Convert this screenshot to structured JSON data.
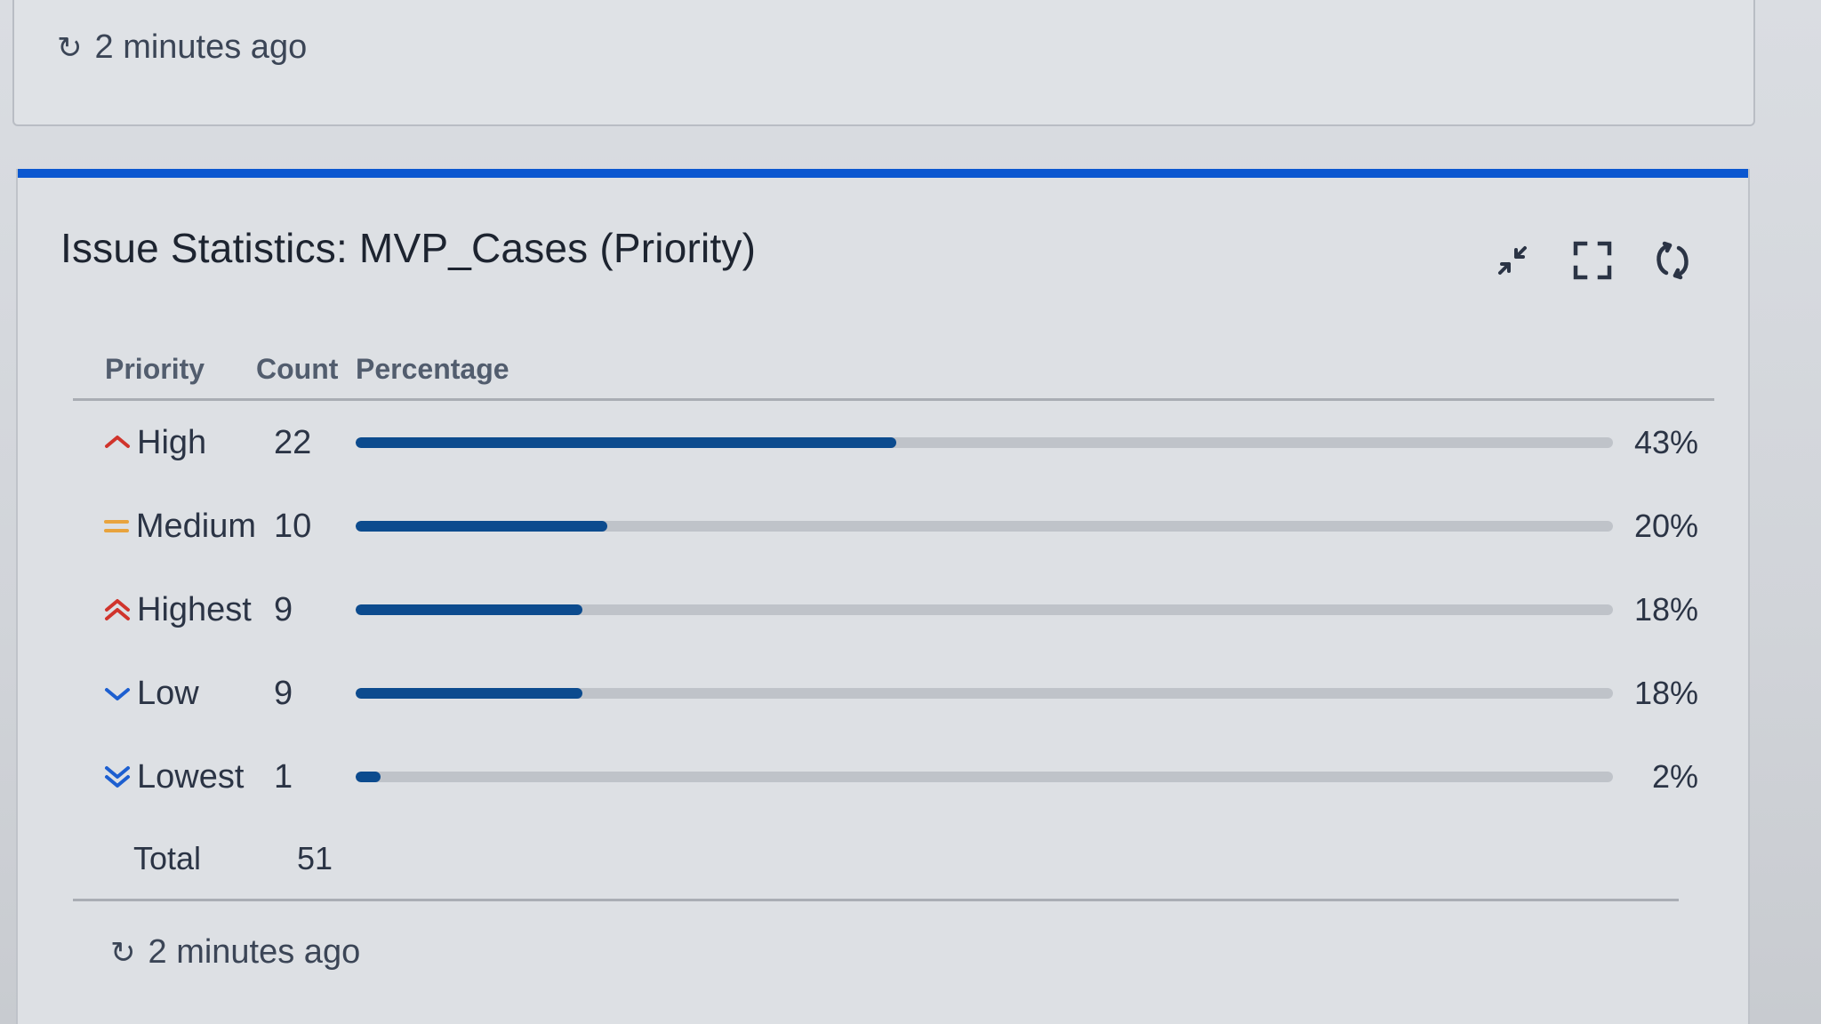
{
  "top_gadget": {
    "refreshed": "2 minutes ago",
    "refresh_icon": "refresh-icon"
  },
  "gadget": {
    "title": "Issue Statistics: MVP_Cases (Priority)",
    "accent_color": "#0b57d0",
    "controls": [
      {
        "name": "minimize",
        "icon": "minimize-icon"
      },
      {
        "name": "maximize",
        "icon": "fullscreen-icon"
      },
      {
        "name": "refresh",
        "icon": "refresh-icon"
      }
    ],
    "columns": {
      "priority": "Priority",
      "count": "Count",
      "percentage": "Percentage"
    },
    "rows": [
      {
        "priority": "High",
        "count": "22",
        "percent": "43%",
        "fraction": 0.43,
        "icon": "priority-high-icon",
        "icon_color": "#d0342c"
      },
      {
        "priority": "Medium",
        "count": "10",
        "percent": "20%",
        "fraction": 0.2,
        "icon": "priority-medium-icon",
        "icon_color": "#e8a33d"
      },
      {
        "priority": "Highest",
        "count": "9",
        "percent": "18%",
        "fraction": 0.18,
        "icon": "priority-highest-icon",
        "icon_color": "#d0342c"
      },
      {
        "priority": "Low",
        "count": "9",
        "percent": "18%",
        "fraction": 0.18,
        "icon": "priority-low-icon",
        "icon_color": "#1d5fd0"
      },
      {
        "priority": "Lowest",
        "count": "1",
        "percent": "2%",
        "fraction": 0.02,
        "icon": "priority-lowest-icon",
        "icon_color": "#1d5fd0"
      }
    ],
    "total": {
      "label": "Total",
      "count": "51"
    },
    "bar_color": "#0c4b8e",
    "track_color": "#bfc3c9",
    "refreshed": "2 minutes ago"
  }
}
